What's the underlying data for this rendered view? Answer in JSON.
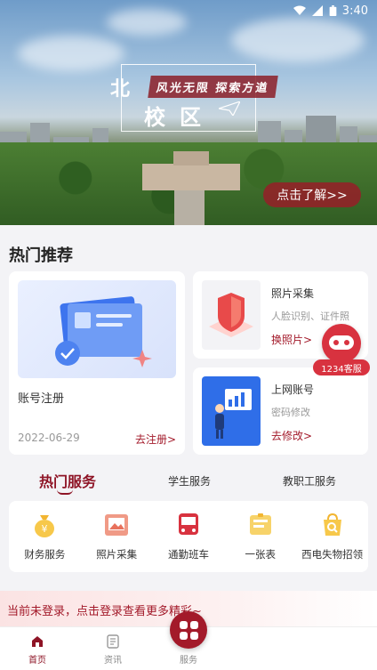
{
  "status_bar": {
    "time": "3:40"
  },
  "banner": {
    "slogan": "风光无限 探索方遒",
    "campus_char": "北",
    "campus_name": "校区",
    "cta": "点击了解>>"
  },
  "hot": {
    "title": "热门推荐",
    "feature": {
      "title": "账号注册",
      "date": "2022-06-29",
      "link": "去注册>"
    },
    "photo": {
      "title": "照片采集",
      "desc": "人脸识别、证件照",
      "link": "换照片>"
    },
    "net": {
      "title": "上网账号",
      "desc": "密码修改",
      "link": "去修改>"
    }
  },
  "service_bubble": {
    "label": "1234客服"
  },
  "tabs": [
    {
      "label": "热门服务"
    },
    {
      "label": "学生服务"
    },
    {
      "label": "教职工服务"
    }
  ],
  "services": [
    {
      "label": "财务服务",
      "icon": "money-bag-icon",
      "color": "#f2b531"
    },
    {
      "label": "照片采集",
      "icon": "photo-icon",
      "color": "#e8715c"
    },
    {
      "label": "通勤班车",
      "icon": "bus-icon",
      "color": "#d8323f"
    },
    {
      "label": "一张表",
      "icon": "form-icon",
      "color": "#f2b531"
    },
    {
      "label": "西电失物招领",
      "icon": "lost-found-icon",
      "color": "#f2b531"
    }
  ],
  "login_banner": {
    "text": "当前未登录，点击登录查看更多精彩~"
  },
  "bottom_nav": [
    {
      "label": "首页",
      "icon": "home-icon"
    },
    {
      "label": "资讯",
      "icon": "news-icon"
    },
    {
      "label": "服务",
      "icon": "grid-icon"
    }
  ],
  "colors": {
    "brand": "#a31a2a",
    "accent": "#8e1426"
  }
}
